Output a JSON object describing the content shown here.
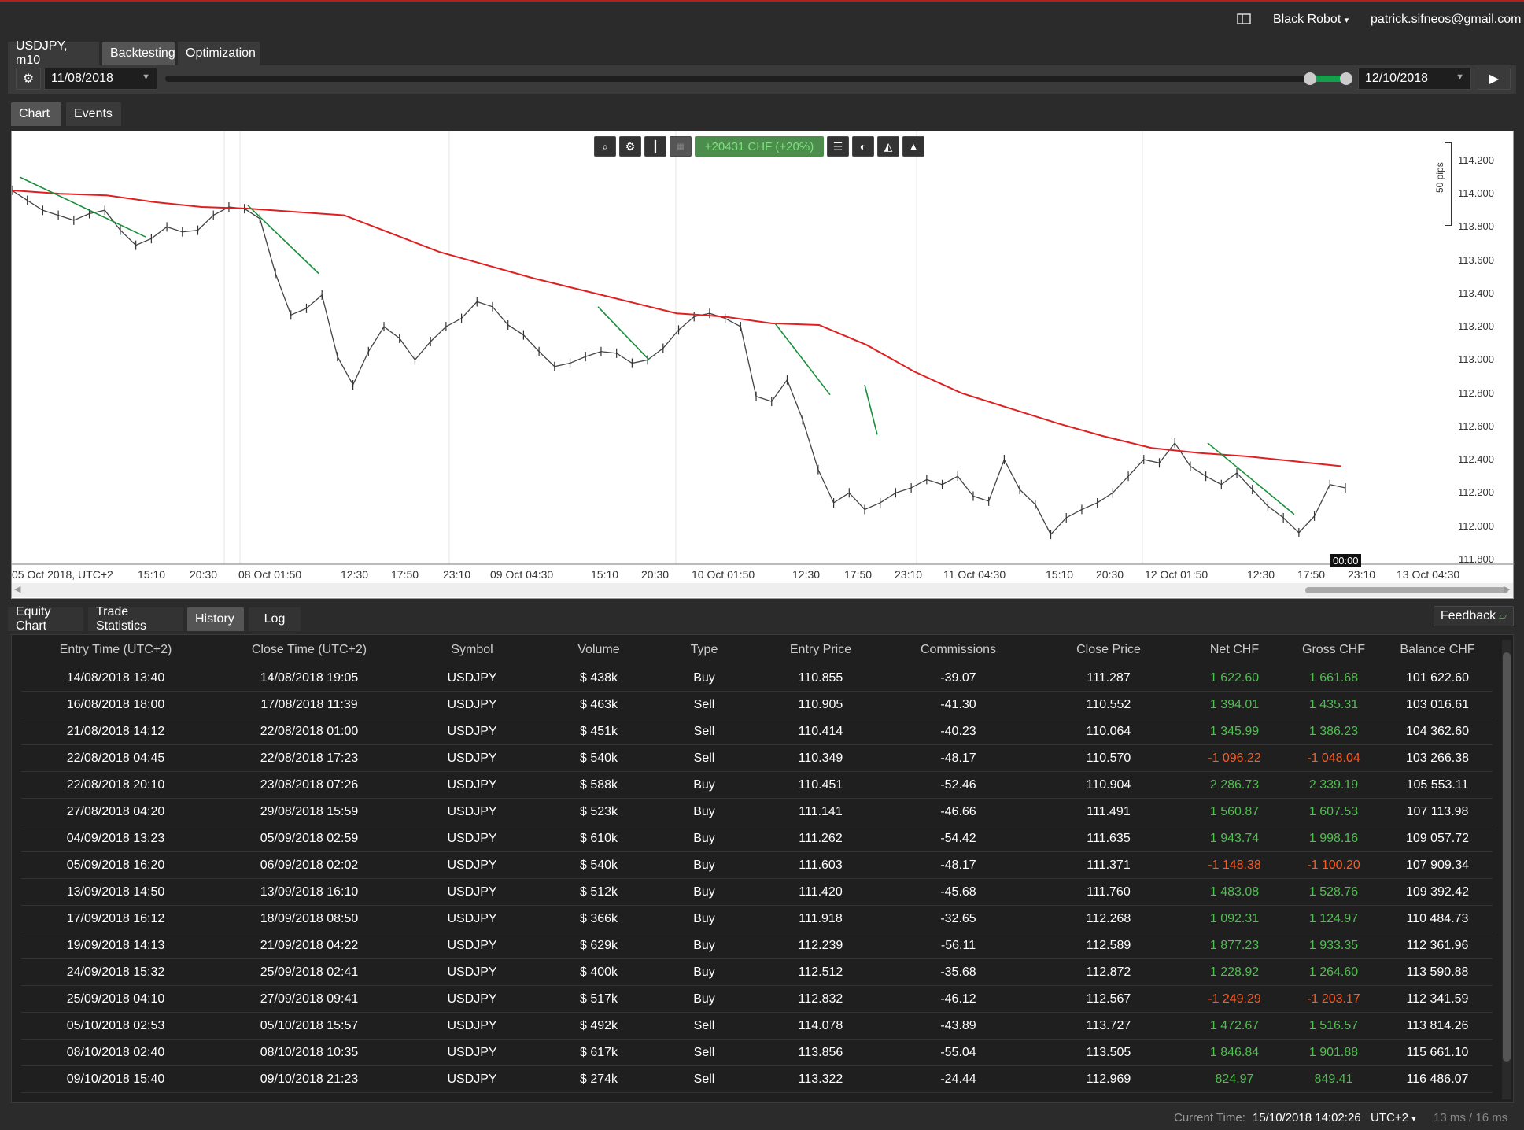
{
  "header": {
    "account": "Black Robot",
    "account_caret": "▾",
    "email": "patrick.sifneos@gmail.com"
  },
  "tabs": [
    {
      "label": "USDJPY, m10",
      "active": false
    },
    {
      "label": "Backtesting",
      "active": true
    },
    {
      "label": "Optimization",
      "active": false
    }
  ],
  "controls": {
    "start_date": "11/08/2018",
    "end_date": "12/10/2018",
    "play_glyph": "▶"
  },
  "chart_tabs": [
    {
      "label": "Chart",
      "active": true
    },
    {
      "label": "Events",
      "active": false
    }
  ],
  "chart": {
    "toolbar_result": "+20431 CHF (+20%)",
    "pips_label": "50 pips",
    "cursor_time": "00:00",
    "y_ticks": [
      "114.200",
      "114.000",
      "113.800",
      "113.600",
      "113.400",
      "113.200",
      "113.000",
      "112.800",
      "112.600",
      "112.400",
      "112.200",
      "112.000",
      "111.800"
    ],
    "x_ticks": [
      "05 Oct 2018, UTC+2",
      "15:10",
      "20:30",
      "08 Oct 01:50",
      "12:30",
      "17:50",
      "23:10",
      "09 Oct 04:30",
      "15:10",
      "20:30",
      "10 Oct 01:50",
      "12:30",
      "17:50",
      "23:10",
      "11 Oct 04:30",
      "15:10",
      "20:30",
      "12 Oct 01:50",
      "12:30",
      "17:50",
      "23:10",
      "13 Oct 04:30"
    ]
  },
  "chart_data": {
    "type": "line",
    "series": [
      {
        "values": [
          114.02,
          113.96,
          113.9,
          113.87,
          113.84,
          113.88,
          113.9,
          113.78,
          113.69,
          113.73,
          113.8,
          113.77,
          113.78,
          113.87,
          113.92,
          113.91,
          113.85,
          113.52,
          113.27,
          113.31,
          113.39,
          113.02,
          112.85,
          113.05,
          113.2,
          113.13,
          113.0,
          113.11,
          113.2,
          113.25,
          113.35,
          113.32,
          113.21,
          113.15,
          113.05,
          112.96,
          112.98,
          113.02,
          113.05,
          113.04,
          112.98,
          113.0,
          113.07,
          113.18,
          113.26,
          113.28,
          113.25,
          113.2,
          112.78,
          112.75,
          112.88,
          112.64,
          112.34,
          112.14,
          112.2,
          112.1,
          112.14,
          112.2,
          112.23,
          112.28,
          112.25,
          112.3,
          112.18,
          112.15,
          112.4,
          112.22,
          112.13,
          111.95,
          112.05,
          112.1,
          112.14,
          112.2,
          112.3,
          112.4,
          112.38,
          112.5,
          112.36,
          112.3,
          112.25,
          112.32,
          112.22,
          112.12,
          112.05,
          111.96,
          112.06,
          112.25,
          112.23
        ]
      },
      {
        "values": [
          114.02,
          114.0,
          113.99,
          113.95,
          113.92,
          113.91,
          113.89,
          113.87,
          113.76,
          113.65,
          113.57,
          113.49,
          113.42,
          113.35,
          113.28,
          113.26,
          113.22,
          113.21,
          113.09,
          112.93,
          112.8,
          112.71,
          112.62,
          112.54,
          112.47,
          112.44,
          112.42,
          112.39,
          112.36
        ]
      },
      {
        "values": [
          114.1,
          113.74,
          113.93,
          113.52,
          113.32,
          113.0,
          113.22,
          112.79,
          112.85,
          112.55,
          112.5,
          112.07
        ]
      }
    ],
    "ylim": [
      111.78,
      114.28
    ],
    "grid": true
  },
  "bottom_tabs": [
    {
      "label": "Equity Chart",
      "active": false
    },
    {
      "label": "Trade Statistics",
      "active": false
    },
    {
      "label": "History",
      "active": true
    },
    {
      "label": "Log",
      "active": false
    }
  ],
  "feedback": "Feedback",
  "table": {
    "headers": [
      "Entry Time (UTC+2)",
      "Close Time (UTC+2)",
      "Symbol",
      "Volume",
      "Type",
      "Entry Price",
      "Commissions",
      "Close Price",
      "Net CHF",
      "Gross CHF",
      "Balance CHF"
    ],
    "rows": [
      [
        "14/08/2018 13:40",
        "14/08/2018 19:05",
        "USDJPY",
        "$ 438k",
        "Buy",
        "110.855",
        "-39.07",
        "111.287",
        "1 622.60",
        "1 661.68",
        "101 622.60"
      ],
      [
        "16/08/2018 18:00",
        "17/08/2018 11:39",
        "USDJPY",
        "$ 463k",
        "Sell",
        "110.905",
        "-41.30",
        "110.552",
        "1 394.01",
        "1 435.31",
        "103 016.61"
      ],
      [
        "21/08/2018 14:12",
        "22/08/2018 01:00",
        "USDJPY",
        "$ 451k",
        "Sell",
        "110.414",
        "-40.23",
        "110.064",
        "1 345.99",
        "1 386.23",
        "104 362.60"
      ],
      [
        "22/08/2018 04:45",
        "22/08/2018 17:23",
        "USDJPY",
        "$ 540k",
        "Sell",
        "110.349",
        "-48.17",
        "110.570",
        "-1 096.22",
        "-1 048.04",
        "103 266.38"
      ],
      [
        "22/08/2018 20:10",
        "23/08/2018 07:26",
        "USDJPY",
        "$ 588k",
        "Buy",
        "110.451",
        "-52.46",
        "110.904",
        "2 286.73",
        "2 339.19",
        "105 553.11"
      ],
      [
        "27/08/2018 04:20",
        "29/08/2018 15:59",
        "USDJPY",
        "$ 523k",
        "Buy",
        "111.141",
        "-46.66",
        "111.491",
        "1 560.87",
        "1 607.53",
        "107 113.98"
      ],
      [
        "04/09/2018 13:23",
        "05/09/2018 02:59",
        "USDJPY",
        "$ 610k",
        "Buy",
        "111.262",
        "-54.42",
        "111.635",
        "1 943.74",
        "1 998.16",
        "109 057.72"
      ],
      [
        "05/09/2018 16:20",
        "06/09/2018 02:02",
        "USDJPY",
        "$ 540k",
        "Buy",
        "111.603",
        "-48.17",
        "111.371",
        "-1 148.38",
        "-1 100.20",
        "107 909.34"
      ],
      [
        "13/09/2018 14:50",
        "13/09/2018 16:10",
        "USDJPY",
        "$ 512k",
        "Buy",
        "111.420",
        "-45.68",
        "111.760",
        "1 483.08",
        "1 528.76",
        "109 392.42"
      ],
      [
        "17/09/2018 16:12",
        "18/09/2018 08:50",
        "USDJPY",
        "$ 366k",
        "Buy",
        "111.918",
        "-32.65",
        "112.268",
        "1 092.31",
        "1 124.97",
        "110 484.73"
      ],
      [
        "19/09/2018 14:13",
        "21/09/2018 04:22",
        "USDJPY",
        "$ 629k",
        "Buy",
        "112.239",
        "-56.11",
        "112.589",
        "1 877.23",
        "1 933.35",
        "112 361.96"
      ],
      [
        "24/09/2018 15:32",
        "25/09/2018 02:41",
        "USDJPY",
        "$ 400k",
        "Buy",
        "112.512",
        "-35.68",
        "112.872",
        "1 228.92",
        "1 264.60",
        "113 590.88"
      ],
      [
        "25/09/2018 04:10",
        "27/09/2018 09:41",
        "USDJPY",
        "$ 517k",
        "Buy",
        "112.832",
        "-46.12",
        "112.567",
        "-1 249.29",
        "-1 203.17",
        "112 341.59"
      ],
      [
        "05/10/2018 02:53",
        "05/10/2018 15:57",
        "USDJPY",
        "$ 492k",
        "Sell",
        "114.078",
        "-43.89",
        "113.727",
        "1 472.67",
        "1 516.57",
        "113 814.26"
      ],
      [
        "08/10/2018 02:40",
        "08/10/2018 10:35",
        "USDJPY",
        "$ 617k",
        "Sell",
        "113.856",
        "-55.04",
        "113.505",
        "1 846.84",
        "1 901.88",
        "115 661.10"
      ],
      [
        "09/10/2018 15:40",
        "09/10/2018 21:23",
        "USDJPY",
        "$ 274k",
        "Sell",
        "113.322",
        "-24.44",
        "112.969",
        "824.97",
        "849.41",
        "116 486.07"
      ]
    ]
  },
  "status": {
    "label": "Current Time:",
    "time": "15/10/2018 14:02:26",
    "tz": "UTC+2",
    "tz_caret": "▾",
    "perf": "13 ms / 16 ms"
  },
  "colors": {
    "positive": "#4fbf4f",
    "negative": "#ff5a1f",
    "ma_line": "#e02020",
    "trade_line": "#1a8f3a",
    "accent": "#b02020"
  }
}
